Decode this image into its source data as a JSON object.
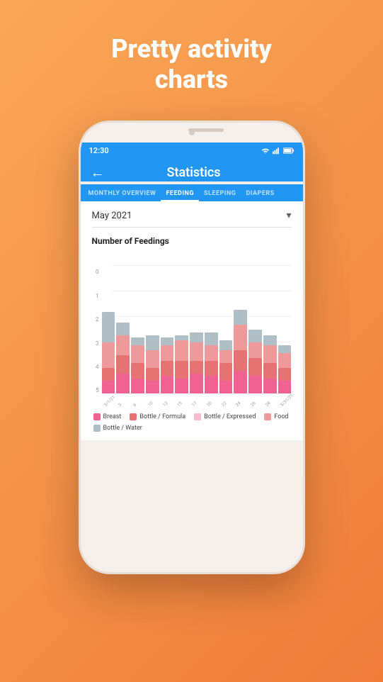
{
  "headline": {
    "line1": "Pretty activity",
    "line2": "charts"
  },
  "statusBar": {
    "time": "12:30",
    "wifiIcon": "wifi",
    "signalIcon": "signal",
    "batteryIcon": "battery"
  },
  "header": {
    "backLabel": "←",
    "title": "Statistics"
  },
  "tabs": [
    {
      "id": "monthly",
      "label": "MONTHLY OVERVIEW",
      "active": false
    },
    {
      "id": "feeding",
      "label": "FEEDING",
      "active": true
    },
    {
      "id": "sleeping",
      "label": "SLEEPING",
      "active": false
    },
    {
      "id": "diapers",
      "label": "DIAPERS",
      "active": false
    }
  ],
  "monthSelector": {
    "label": "May 2021",
    "arrowIcon": "▾"
  },
  "chart": {
    "title": "Number of Feedings",
    "yLabels": [
      "0",
      "1",
      "2",
      "3",
      "4",
      "5"
    ],
    "maxValue": 5,
    "bars": [
      {
        "label": "5/1/21",
        "breast": 0.5,
        "formula": 0.5,
        "expressed": 0,
        "food": 1,
        "water": 1.2
      },
      {
        "label": "3",
        "breast": 0.8,
        "formula": 0.7,
        "expressed": 0,
        "food": 0.8,
        "water": 0.5
      },
      {
        "label": "6",
        "breast": 0.6,
        "formula": 0.6,
        "expressed": 0,
        "food": 0.7,
        "water": 0.3
      },
      {
        "label": "10",
        "breast": 0.5,
        "formula": 0.5,
        "expressed": 0,
        "food": 0.7,
        "water": 0.6
      },
      {
        "label": "12",
        "breast": 0.7,
        "formula": 0.6,
        "expressed": 0,
        "food": 0.6,
        "water": 0.3
      },
      {
        "label": "15",
        "breast": 0.6,
        "formula": 0.7,
        "expressed": 0,
        "food": 0.8,
        "water": 0.2
      },
      {
        "label": "17",
        "breast": 0.8,
        "formula": 0.5,
        "expressed": 0,
        "food": 0.7,
        "water": 0.4
      },
      {
        "label": "20",
        "breast": 0.7,
        "formula": 0.6,
        "expressed": 0,
        "food": 0.6,
        "water": 0.5
      },
      {
        "label": "22",
        "breast": 0.5,
        "formula": 0.7,
        "expressed": 0,
        "food": 0.5,
        "water": 0.4
      },
      {
        "label": "24",
        "breast": 0.9,
        "formula": 0.8,
        "expressed": 0,
        "food": 1.0,
        "water": 0.6
      },
      {
        "label": "26",
        "breast": 0.7,
        "formula": 0.7,
        "expressed": 0,
        "food": 0.6,
        "water": 0.5
      },
      {
        "label": "28",
        "breast": 0.6,
        "formula": 0.6,
        "expressed": 0,
        "food": 0.7,
        "water": 0.4
      },
      {
        "label": "5/31/21",
        "breast": 0.5,
        "formula": 0.5,
        "expressed": 0,
        "food": 0.6,
        "water": 0.3
      }
    ],
    "colors": {
      "breast": "#f06292",
      "formula": "#e57373",
      "expressed": "#f8bbd0",
      "food": "#ef9a9a",
      "water": "#b0bec5"
    }
  },
  "legend": [
    {
      "id": "breast",
      "label": "Breast",
      "color": "#f06292"
    },
    {
      "id": "formula",
      "label": "Bottle / Formula",
      "color": "#e57373"
    },
    {
      "id": "expressed",
      "label": "Bottle / Expressed",
      "color": "#f8bbd0"
    },
    {
      "id": "food",
      "label": "Food",
      "color": "#ef9a9a"
    },
    {
      "id": "water",
      "label": "Bottle / Water",
      "color": "#b0bec5"
    }
  ]
}
